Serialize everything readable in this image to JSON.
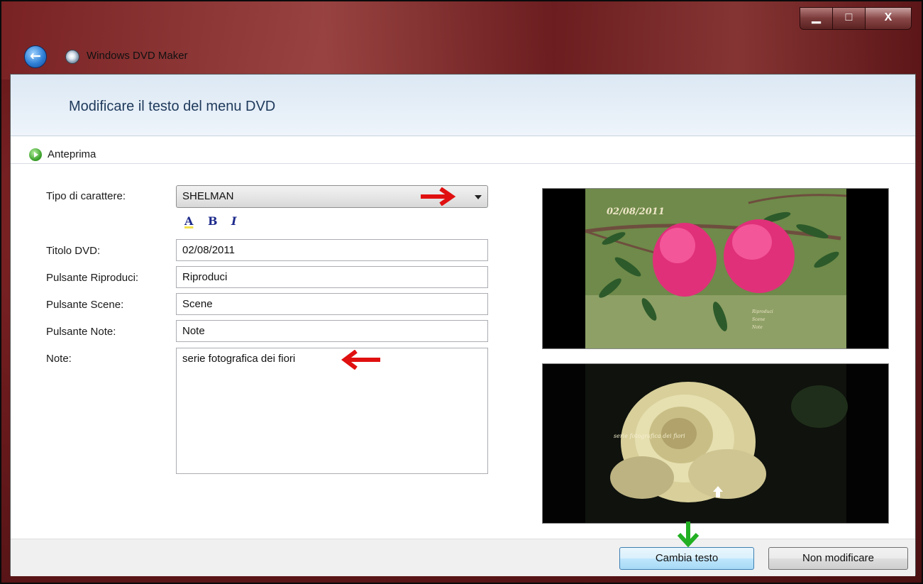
{
  "titlebar": {
    "app_title": "Windows DVD Maker",
    "back_icon": "back-arrow-icon",
    "app_icon": "dvd-maker-icon",
    "controls": {
      "minimize": "▁",
      "maximize": "□",
      "close": "X"
    }
  },
  "header": {
    "title": "Modificare il testo del menu DVD"
  },
  "toolbar": {
    "preview_label": "Anteprima",
    "preview_icon": "play-icon"
  },
  "form": {
    "font_label": "Tipo di carattere:",
    "font_value": "SHELMAN",
    "format_buttons": {
      "color": "A",
      "bold": "B",
      "italic": "I"
    },
    "dvd_title_label": "Titolo DVD:",
    "dvd_title_value": "02/08/2011",
    "play_label": "Pulsante Riproduci:",
    "play_value": "Riproduci",
    "scenes_label": "Pulsante Scene:",
    "scenes_value": "Scene",
    "notes_button_label": "Pulsante Note:",
    "notes_button_value": "Note",
    "notes_label": "Note:",
    "notes_value": "serie fotografica dei fiori"
  },
  "previews": {
    "top": {
      "overlay_title": "02/08/2011",
      "menu_items": [
        "Riproduci",
        "Scene",
        "Note"
      ]
    },
    "bottom": {
      "overlay_text": "serie fotografica dei fiori"
    }
  },
  "footer": {
    "primary_button": "Cambia testo",
    "secondary_button": "Non modificare"
  },
  "colors": {
    "accent_red": "#e01010",
    "accent_green": "#22b022",
    "header_text": "#1e395b"
  }
}
